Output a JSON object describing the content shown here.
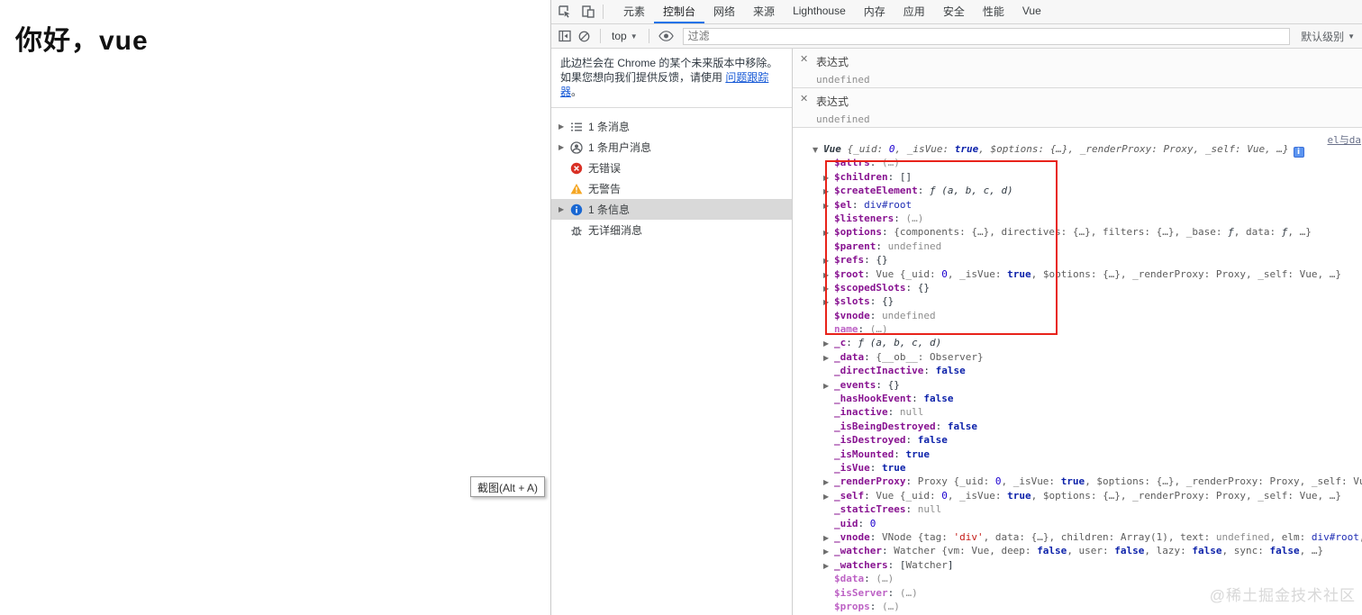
{
  "page": {
    "title": "你好，vue",
    "tooltip": "截图(Alt + A)",
    "watermark": "@稀土掘金技术社区"
  },
  "colors": {
    "accent_blue": "#1a73e8",
    "annotation_red": "#e8231a",
    "property_purple": "#881391",
    "faded_purple": "#bd62c5",
    "error_red": "#d93025",
    "warning_amber": "#f5a623",
    "info_blue": "#1967d2"
  },
  "devtools": {
    "tabs": [
      {
        "label": "元素",
        "active": false
      },
      {
        "label": "控制台",
        "active": true
      },
      {
        "label": "网络",
        "active": false
      },
      {
        "label": "来源",
        "active": false
      },
      {
        "label": "Lighthouse",
        "active": false
      },
      {
        "label": "内存",
        "active": false
      },
      {
        "label": "应用",
        "active": false
      },
      {
        "label": "安全",
        "active": false
      },
      {
        "label": "性能",
        "active": false
      },
      {
        "label": "Vue",
        "active": false
      }
    ],
    "toolbar": {
      "context": "top",
      "filter_placeholder": "过滤",
      "levels_label": "默认级别"
    },
    "sidebar": {
      "notice": {
        "text_before": "此边栏会在 Chrome 的某个未来版本中移除。如果您想向我们提供反馈，请使用 ",
        "link": "问题跟踪器",
        "text_after": "。"
      },
      "items": [
        {
          "icon": "list-icon",
          "label": "1 条消息",
          "expandable": true,
          "selected": false
        },
        {
          "icon": "user-icon",
          "label": "1 条用户消息",
          "expandable": true,
          "selected": false
        },
        {
          "icon": "error-icon",
          "label": "无错误",
          "expandable": false,
          "selected": false
        },
        {
          "icon": "warning-icon",
          "label": "无警告",
          "expandable": false,
          "selected": false
        },
        {
          "icon": "info-icon",
          "label": "1 条信息",
          "expandable": true,
          "selected": true
        },
        {
          "icon": "verbose-icon",
          "label": "无详细消息",
          "expandable": false,
          "selected": false
        }
      ]
    },
    "console": {
      "expressions": [
        {
          "label": "表达式",
          "value": "undefined"
        },
        {
          "label": "表达式",
          "value": "undefined"
        }
      ],
      "source_link": "el与da",
      "rows": [
        {
          "ind": 0,
          "italic": true,
          "segs": [
            [
              "arrd",
              "▼"
            ],
            [
              "obj",
              "Vue "
            ],
            [
              "pk",
              "{_uid: "
            ],
            [
              "num",
              "0"
            ],
            [
              "pk",
              ", _isVue: "
            ],
            [
              "bool",
              "true"
            ],
            [
              "pk",
              ", $options: {…}, _renderProxy: Proxy, _self: Vue, …}"
            ],
            [
              "info",
              "i"
            ]
          ]
        },
        {
          "ind": 1,
          "segs": [
            [
              "sp",
              ""
            ],
            [
              "nm",
              "$attrs"
            ],
            [
              "pl",
              ": "
            ],
            [
              "gr",
              "(…)"
            ]
          ]
        },
        {
          "ind": 1,
          "segs": [
            [
              "arr",
              "▶"
            ],
            [
              "nm",
              "$children"
            ],
            [
              "pl",
              ": "
            ],
            [
              "pl",
              "[]"
            ]
          ]
        },
        {
          "ind": 1,
          "segs": [
            [
              "arr",
              "▶"
            ],
            [
              "nm",
              "$createElement"
            ],
            [
              "pl",
              ": "
            ],
            [
              "fn",
              "ƒ (a, b, c, d)"
            ]
          ]
        },
        {
          "ind": 1,
          "segs": [
            [
              "arr",
              "▶"
            ],
            [
              "nm",
              "$el"
            ],
            [
              "pl",
              ": "
            ],
            [
              "node",
              "div#root"
            ]
          ]
        },
        {
          "ind": 1,
          "segs": [
            [
              "sp",
              ""
            ],
            [
              "nm",
              "$listeners"
            ],
            [
              "pl",
              ": "
            ],
            [
              "gr",
              "(…)"
            ]
          ]
        },
        {
          "ind": 1,
          "segs": [
            [
              "arr",
              "▶"
            ],
            [
              "nm",
              "$options"
            ],
            [
              "pl",
              ": "
            ],
            [
              "pk",
              "{components: {…}, directives: {…}, filters: {…}, _base: "
            ],
            [
              "fn",
              "ƒ"
            ],
            [
              "pk",
              ", data: "
            ],
            [
              "fn",
              "ƒ"
            ],
            [
              "pk",
              ", …}"
            ]
          ]
        },
        {
          "ind": 1,
          "segs": [
            [
              "sp",
              ""
            ],
            [
              "nm",
              "$parent"
            ],
            [
              "pl",
              ": "
            ],
            [
              "gr",
              "undefined"
            ]
          ]
        },
        {
          "ind": 1,
          "segs": [
            [
              "arr",
              "▶"
            ],
            [
              "nm",
              "$refs"
            ],
            [
              "pl",
              ": "
            ],
            [
              "pl",
              "{}"
            ]
          ]
        },
        {
          "ind": 1,
          "segs": [
            [
              "arr",
              "▶"
            ],
            [
              "nm",
              "$root"
            ],
            [
              "pl",
              ": "
            ],
            [
              "pk",
              "Vue {_uid: "
            ],
            [
              "num",
              "0"
            ],
            [
              "pk",
              ", _isVue: "
            ],
            [
              "bool",
              "true"
            ],
            [
              "pk",
              ", $options: {…}, _renderProxy: Proxy, _self: Vue, …}"
            ]
          ]
        },
        {
          "ind": 1,
          "segs": [
            [
              "arr",
              "▶"
            ],
            [
              "nm",
              "$scopedSlots"
            ],
            [
              "pl",
              ": "
            ],
            [
              "pl",
              "{}"
            ]
          ]
        },
        {
          "ind": 1,
          "segs": [
            [
              "arr",
              "▶"
            ],
            [
              "nm",
              "$slots"
            ],
            [
              "pl",
              ": "
            ],
            [
              "pl",
              "{}"
            ]
          ]
        },
        {
          "ind": 1,
          "segs": [
            [
              "sp",
              ""
            ],
            [
              "nm",
              "$vnode"
            ],
            [
              "pl",
              ": "
            ],
            [
              "gr",
              "undefined"
            ]
          ]
        },
        {
          "ind": 1,
          "segs": [
            [
              "sp",
              ""
            ],
            [
              "fnm",
              "name"
            ],
            [
              "pl",
              ": "
            ],
            [
              "gr",
              "(…)"
            ]
          ]
        },
        {
          "ind": 1,
          "segs": [
            [
              "arr",
              "▶"
            ],
            [
              "nm",
              "_c"
            ],
            [
              "pl",
              ": "
            ],
            [
              "fn",
              "ƒ (a, b, c, d)"
            ]
          ]
        },
        {
          "ind": 1,
          "segs": [
            [
              "arr",
              "▶"
            ],
            [
              "nm",
              "_data"
            ],
            [
              "pl",
              ": "
            ],
            [
              "pk",
              "{__ob__: Observer}"
            ]
          ]
        },
        {
          "ind": 1,
          "segs": [
            [
              "sp",
              ""
            ],
            [
              "nm",
              "_directInactive"
            ],
            [
              "pl",
              ": "
            ],
            [
              "bool",
              "false"
            ]
          ]
        },
        {
          "ind": 1,
          "segs": [
            [
              "arr",
              "▶"
            ],
            [
              "nm",
              "_events"
            ],
            [
              "pl",
              ": "
            ],
            [
              "pl",
              "{}"
            ]
          ]
        },
        {
          "ind": 1,
          "segs": [
            [
              "sp",
              ""
            ],
            [
              "nm",
              "_hasHookEvent"
            ],
            [
              "pl",
              ": "
            ],
            [
              "bool",
              "false"
            ]
          ]
        },
        {
          "ind": 1,
          "segs": [
            [
              "sp",
              ""
            ],
            [
              "nm",
              "_inactive"
            ],
            [
              "pl",
              ": "
            ],
            [
              "gr",
              "null"
            ]
          ]
        },
        {
          "ind": 1,
          "segs": [
            [
              "sp",
              ""
            ],
            [
              "nm",
              "_isBeingDestroyed"
            ],
            [
              "pl",
              ": "
            ],
            [
              "bool",
              "false"
            ]
          ]
        },
        {
          "ind": 1,
          "segs": [
            [
              "sp",
              ""
            ],
            [
              "nm",
              "_isDestroyed"
            ],
            [
              "pl",
              ": "
            ],
            [
              "bool",
              "false"
            ]
          ]
        },
        {
          "ind": 1,
          "segs": [
            [
              "sp",
              ""
            ],
            [
              "nm",
              "_isMounted"
            ],
            [
              "pl",
              ": "
            ],
            [
              "bool",
              "true"
            ]
          ]
        },
        {
          "ind": 1,
          "segs": [
            [
              "sp",
              ""
            ],
            [
              "nm",
              "_isVue"
            ],
            [
              "pl",
              ": "
            ],
            [
              "bool",
              "true"
            ]
          ]
        },
        {
          "ind": 1,
          "segs": [
            [
              "arr",
              "▶"
            ],
            [
              "nm",
              "_renderProxy"
            ],
            [
              "pl",
              ": "
            ],
            [
              "pk",
              "Proxy {_uid: "
            ],
            [
              "num",
              "0"
            ],
            [
              "pk",
              ", _isVue: "
            ],
            [
              "bool",
              "true"
            ],
            [
              "pk",
              ", $options: {…}, _renderProxy: Proxy, _self: Vue, …}"
            ]
          ]
        },
        {
          "ind": 1,
          "segs": [
            [
              "arr",
              "▶"
            ],
            [
              "nm",
              "_self"
            ],
            [
              "pl",
              ": "
            ],
            [
              "pk",
              "Vue {_uid: "
            ],
            [
              "num",
              "0"
            ],
            [
              "pk",
              ", _isVue: "
            ],
            [
              "bool",
              "true"
            ],
            [
              "pk",
              ", $options: {…}, _renderProxy: Proxy, _self: Vue, …}"
            ]
          ]
        },
        {
          "ind": 1,
          "segs": [
            [
              "sp",
              ""
            ],
            [
              "nm",
              "_staticTrees"
            ],
            [
              "pl",
              ": "
            ],
            [
              "gr",
              "null"
            ]
          ]
        },
        {
          "ind": 1,
          "segs": [
            [
              "sp",
              ""
            ],
            [
              "nm",
              "_uid"
            ],
            [
              "pl",
              ": "
            ],
            [
              "num",
              "0"
            ]
          ]
        },
        {
          "ind": 1,
          "segs": [
            [
              "arr",
              "▶"
            ],
            [
              "nm",
              "_vnode"
            ],
            [
              "pl",
              ": "
            ],
            [
              "pk",
              "VNode {tag: "
            ],
            [
              "str",
              "'div'"
            ],
            [
              "pk",
              ", data: {…}, children: Array(1), text: "
            ],
            [
              "gr",
              "undefined"
            ],
            [
              "pk",
              ", elm: "
            ],
            [
              "node",
              "div#root"
            ],
            [
              "pk",
              ", …}"
            ]
          ]
        },
        {
          "ind": 1,
          "segs": [
            [
              "arr",
              "▶"
            ],
            [
              "nm",
              "_watcher"
            ],
            [
              "pl",
              ": "
            ],
            [
              "pk",
              "Watcher {vm: Vue, deep: "
            ],
            [
              "bool",
              "false"
            ],
            [
              "pk",
              ", user: "
            ],
            [
              "bool",
              "false"
            ],
            [
              "pk",
              ", lazy: "
            ],
            [
              "bool",
              "false"
            ],
            [
              "pk",
              ", sync: "
            ],
            [
              "bool",
              "false"
            ],
            [
              "pk",
              ", …}"
            ]
          ]
        },
        {
          "ind": 1,
          "segs": [
            [
              "arr",
              "▶"
            ],
            [
              "nm",
              "_watchers"
            ],
            [
              "pl",
              ": "
            ],
            [
              "pl",
              "["
            ],
            [
              "pk",
              "Watcher"
            ],
            [
              "pl",
              "]"
            ]
          ]
        },
        {
          "ind": 1,
          "segs": [
            [
              "sp",
              ""
            ],
            [
              "fnm",
              "$data"
            ],
            [
              "pl",
              ": "
            ],
            [
              "gr",
              "(…)"
            ]
          ]
        },
        {
          "ind": 1,
          "segs": [
            [
              "sp",
              ""
            ],
            [
              "fnm",
              "$isServer"
            ],
            [
              "pl",
              ": "
            ],
            [
              "gr",
              "(…)"
            ]
          ]
        },
        {
          "ind": 1,
          "segs": [
            [
              "sp",
              ""
            ],
            [
              "fnm",
              "$props"
            ],
            [
              "pl",
              ": "
            ],
            [
              "gr",
              "(…)"
            ]
          ]
        }
      ]
    }
  }
}
